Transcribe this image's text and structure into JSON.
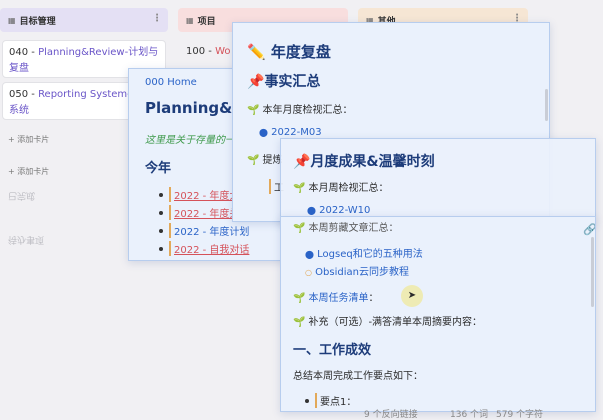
{
  "kanban": {
    "col1": {
      "title": "目标管理",
      "cards": [
        {
          "num": "040 - ",
          "link": "Planning&Review-计划与复盘"
        },
        {
          "num": "050 - ",
          "link": "Reporting System-报告系统"
        }
      ],
      "add_card": "+ 添加卡片",
      "ghost1": "已完成",
      "ghost2": "待办事项"
    },
    "col2": {
      "title": "项目",
      "card": {
        "num": "100 - ",
        "link": "Wo"
      }
    },
    "col3": {
      "title": "其他"
    }
  },
  "pop_home": {
    "breadcrumb": "000 Home",
    "title": "Planning&R",
    "italic": "这里是关于存量的一",
    "section": "今年",
    "items": [
      "2022 - 年度大",
      "2022 - 年度关键",
      "2022 - 年度计划",
      "2022 - 自我对话"
    ]
  },
  "pop_year": {
    "title": "年度复盘",
    "section": "事实汇总",
    "line1": "本年月度检视汇总：",
    "month": "2022-M03",
    "line2": "提炼",
    "line3": "工"
  },
  "pop_month": {
    "title": "月度成果&温馨时刻",
    "line1": "本月周检视汇总：",
    "week": "2022-W10"
  },
  "pop_week": {
    "line0": "本周剪藏文章汇总：",
    "links": [
      "Logseq和它的五种用法",
      "Obsidian云同步教程"
    ],
    "task_list": "本周任务清单",
    "task_colon": "：",
    "supplement": "补充（可选）-满答清单本周摘要内容：",
    "heading": "一、工作成效",
    "summary": "总结本周完成工作要点如下：",
    "point1": "要点1："
  },
  "status": {
    "backlinks": "9 个反向链接",
    "words": "136 个词",
    "chars": "579 个字符"
  },
  "icons": [
    "pencil-icon",
    "pin-icon",
    "sprout-icon",
    "link-icon",
    "cursor-icon"
  ]
}
